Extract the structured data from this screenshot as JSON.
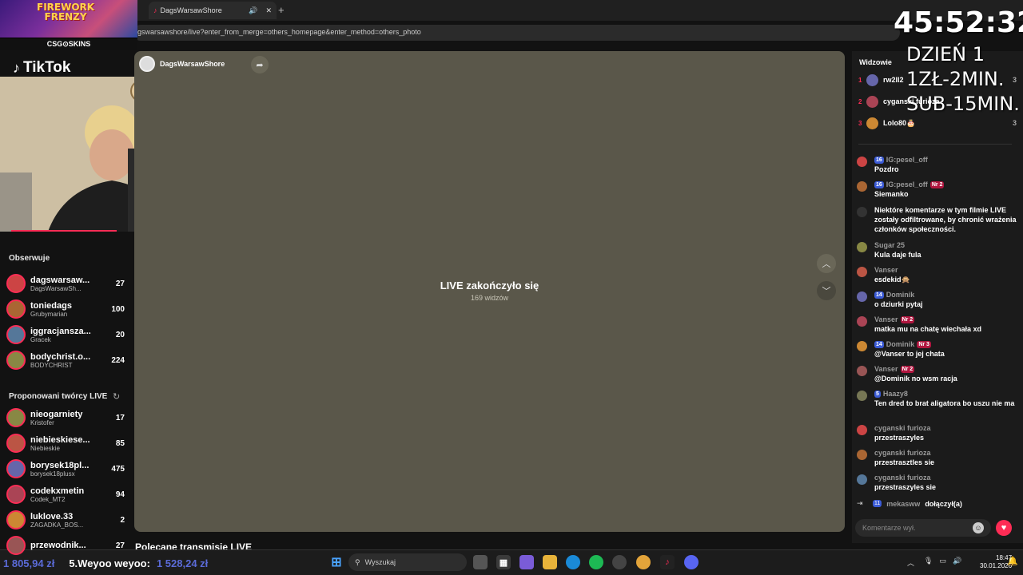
{
  "browser": {
    "tab_title": "DagsWarsawShore",
    "url": "gswarsawshore/live?enter_from_merge=others_homepage&enter_method=others_photo"
  },
  "overlay": {
    "game_title_1": "FIREWORK",
    "game_title_2": "FRENZY",
    "sponsor": "CSG⊙SKINS",
    "timer": "45:52:32",
    "day": "DZIEŃ 1",
    "rate_1": "1ZŁ-2MIN.",
    "rate_2": "SUB-15MIN."
  },
  "logo": "TikTok",
  "sidebar": {
    "following_title": "Obserwuje",
    "following": [
      {
        "name": "dagswarsaw...",
        "sub": "DagsWarsawSh...",
        "count": "27"
      },
      {
        "name": "toniedags",
        "sub": "Grubymarian",
        "count": "100"
      },
      {
        "name": "iggracjansza...",
        "sub": "Gracek",
        "count": "20"
      },
      {
        "name": "bodychrist.o...",
        "sub": "BODYCHRIST",
        "count": "224"
      }
    ],
    "suggested_title": "Proponowani twórcy LIVE",
    "suggested": [
      {
        "name": "nieogarniety",
        "sub": "Kristofer",
        "count": "17"
      },
      {
        "name": "niebieskiese...",
        "sub": "Niebieskie",
        "count": "85"
      },
      {
        "name": "borysek18pl...",
        "sub": "borysek18plusx",
        "count": "475"
      },
      {
        "name": "codekxmetin",
        "sub": "Codek_MT2",
        "count": "94"
      },
      {
        "name": "luklove.33",
        "sub": "ZAGADKA_BOS...",
        "count": "2"
      },
      {
        "name": "przewodnik...",
        "sub": "",
        "count": "27"
      }
    ]
  },
  "player": {
    "host_name": "DagsWarsawShore",
    "status": "LIVE zakończyło się",
    "viewers": "169 widzów"
  },
  "recommended_title": "Polecane transmisje LIVE",
  "viewers_panel": {
    "title": "Widzowie",
    "list": [
      {
        "rank": "1",
        "name": "rw2ll2",
        "score": "3"
      },
      {
        "rank": "2",
        "name": "cyganski furioza",
        "score": ""
      },
      {
        "rank": "3",
        "name": "Lolo80🎂",
        "score": "3"
      }
    ]
  },
  "chat": [
    {
      "user": "IG:pesel_off",
      "level": "16",
      "badge": "",
      "msg": "Pozdro"
    },
    {
      "user": "IG:pesel_off",
      "level": "16",
      "badge": "Nr 2",
      "msg": "Siemanko"
    },
    {
      "user": "",
      "level": "",
      "badge": "",
      "msg": "Niektóre komentarze w tym filmie LIVE zostały odfiltrowane, by chronić wrażenia członków społeczności."
    },
    {
      "user": "Sugar 25",
      "level": "",
      "badge": "",
      "msg": "Kula daje fula"
    },
    {
      "user": "Vanser",
      "level": "",
      "badge": "",
      "msg": "esdekid🙊"
    },
    {
      "user": "Dominik",
      "level": "14",
      "badge": "",
      "msg": "o dziurki pytaj"
    },
    {
      "user": "Vanser",
      "level": "",
      "badge": "Nr 2",
      "msg": "matka mu na chatę wiechała xd"
    },
    {
      "user": "Dominik",
      "level": "14",
      "badge": "Nr 3",
      "msg": "@Vanser to jej chata"
    },
    {
      "user": "Vanser",
      "level": "",
      "badge": "Nr 2",
      "msg": "@Dominik no wsm racja"
    },
    {
      "user": "Haazy8",
      "level": "5",
      "badge": "",
      "msg": "Ten dred to brat aligatora bo uszu nie ma"
    },
    {
      "user": "cyganski furioza",
      "level": "",
      "badge": "",
      "msg": "przestraszyles"
    },
    {
      "user": "cyganski furioza",
      "level": "",
      "badge": "",
      "msg": "przestrasztles sie"
    },
    {
      "user": "cyganski furioza",
      "level": "",
      "badge": "",
      "msg": "przestraszyles sie"
    }
  ],
  "join_notice": {
    "level": "11",
    "user": "mekasww",
    "text": "dołączył(a)"
  },
  "comment_placeholder": "Komentarze wył.",
  "donation": {
    "amount_1": "1 805,94 zł",
    "entry": "5.Weyoo weyoo:",
    "amount_2": "1 528,24 zł"
  },
  "taskbar": {
    "search": "Wyszukaj",
    "time": "18:47",
    "date": "30.01.2026"
  }
}
